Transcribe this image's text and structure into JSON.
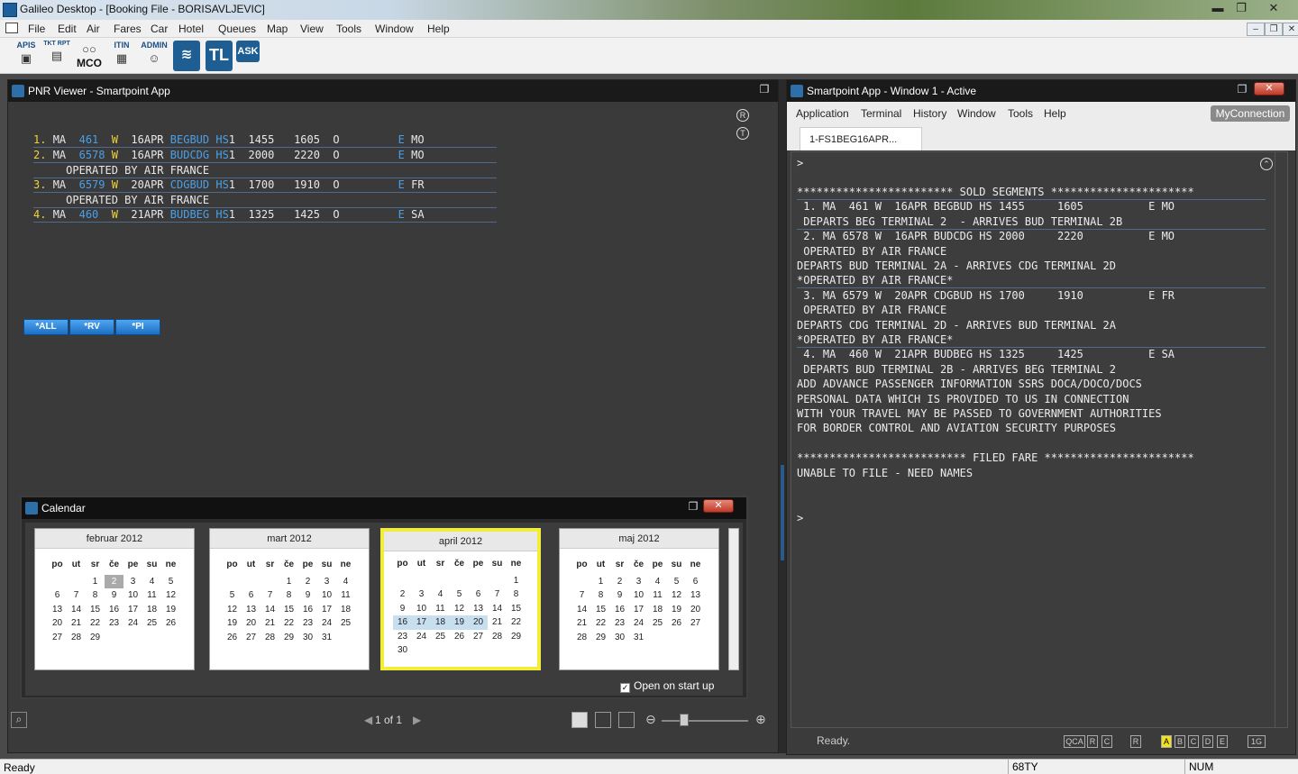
{
  "window": {
    "title": "Galileo Desktop - [Booking File - BORISAVLJEVIC]"
  },
  "menu": [
    "File",
    "Edit",
    "Air",
    "Fares",
    "Car",
    "Hotel",
    "Queues",
    "Map",
    "View",
    "Tools",
    "Window",
    "Help"
  ],
  "toolbar": {
    "apis": "APIS",
    "tkt": "TKT RPT",
    "mco": "MCO",
    "itin": "ITIN",
    "admin": "ADMIN",
    "tl": "TL",
    "ask": "ASK"
  },
  "pnr": {
    "title": "PNR Viewer - Smartpoint App",
    "icon_r": "R",
    "icon_t": "T",
    "segments": [
      {
        "num": "1.",
        "car": "MA",
        "flt": "461",
        "cls": "W",
        "date": "16APR",
        "city": "BEGBUD",
        "hs": "HS",
        "n": "1",
        "dep": "1455",
        "arr": "1605",
        "o": "O",
        "e": "E",
        "day": "MO"
      },
      {
        "num": "2.",
        "car": "MA",
        "flt": "6578",
        "cls": "W",
        "date": "16APR",
        "city": "BUDCDG",
        "hs": "HS",
        "n": "1",
        "dep": "2000",
        "arr": "2220",
        "o": "O",
        "e": "E",
        "day": "MO",
        "op": "OPERATED BY AIR FRANCE"
      },
      {
        "num": "3.",
        "car": "MA",
        "flt": "6579",
        "cls": "W",
        "date": "20APR",
        "city": "CDGBUD",
        "hs": "HS",
        "n": "1",
        "dep": "1700",
        "arr": "1910",
        "o": "O",
        "e": "E",
        "day": "FR",
        "op": "OPERATED BY AIR FRANCE"
      },
      {
        "num": "4.",
        "car": "MA",
        "flt": "460",
        "cls": "W",
        "date": "21APR",
        "city": "BUDBEG",
        "hs": "HS",
        "n": "1",
        "dep": "1325",
        "arr": "1425",
        "o": "O",
        "e": "E",
        "day": "SA"
      }
    ],
    "buttons": [
      "*ALL",
      "*RV",
      "*PI"
    ],
    "page": "1 of 1"
  },
  "calendar": {
    "title": "Calendar",
    "weekdays": [
      "po",
      "ut",
      "sr",
      "če",
      "pe",
      "su",
      "ne"
    ],
    "open_on_start": "Open on start up",
    "months": [
      {
        "name": "februar 2012",
        "weeks": [
          [
            "",
            "",
            "1",
            "2",
            "3",
            "4",
            "5"
          ],
          [
            "6",
            "7",
            "8",
            "9",
            "10",
            "11",
            "12"
          ],
          [
            "13",
            "14",
            "15",
            "16",
            "17",
            "18",
            "19"
          ],
          [
            "20",
            "21",
            "22",
            "23",
            "24",
            "25",
            "26"
          ],
          [
            "27",
            "28",
            "29",
            "",
            "",
            "",
            ""
          ]
        ]
      },
      {
        "name": "mart 2012",
        "weeks": [
          [
            "",
            "",
            "",
            "1",
            "2",
            "3",
            "4"
          ],
          [
            "5",
            "6",
            "7",
            "8",
            "9",
            "10",
            "11"
          ],
          [
            "12",
            "13",
            "14",
            "15",
            "16",
            "17",
            "18"
          ],
          [
            "19",
            "20",
            "21",
            "22",
            "23",
            "24",
            "25"
          ],
          [
            "26",
            "27",
            "28",
            "29",
            "30",
            "31",
            ""
          ]
        ]
      },
      {
        "name": "april 2012",
        "weeks": [
          [
            "",
            "",
            "",
            "",
            "",
            "",
            "1"
          ],
          [
            "2",
            "3",
            "4",
            "5",
            "6",
            "7",
            "8"
          ],
          [
            "9",
            "10",
            "11",
            "12",
            "13",
            "14",
            "15"
          ],
          [
            "16",
            "17",
            "18",
            "19",
            "20",
            "21",
            "22"
          ],
          [
            "23",
            "24",
            "25",
            "26",
            "27",
            "28",
            "29"
          ],
          [
            "30",
            "",
            "",
            "",
            "",
            "",
            ""
          ]
        ]
      },
      {
        "name": "maj 2012",
        "weeks": [
          [
            "",
            "1",
            "2",
            "3",
            "4",
            "5",
            "6"
          ],
          [
            "7",
            "8",
            "9",
            "10",
            "11",
            "12",
            "13"
          ],
          [
            "14",
            "15",
            "16",
            "17",
            "18",
            "19",
            "20"
          ],
          [
            "21",
            "22",
            "23",
            "24",
            "25",
            "26",
            "27"
          ],
          [
            "28",
            "29",
            "30",
            "31",
            "",
            "",
            ""
          ]
        ]
      }
    ]
  },
  "smartpoint": {
    "title": "Smartpoint App - Window 1 - Active",
    "menu": [
      "Application",
      "Terminal",
      "History",
      "Window",
      "Tools",
      "Help"
    ],
    "connection": "MyConnection",
    "tab": "1-FS1BEG16APR...",
    "prompt": ">",
    "lines": [
      "************************ SOLD SEGMENTS **********************",
      " 1. MA  461 W  16APR BEGBUD HS 1455     1605          E MO",
      " DEPARTS BEG TERMINAL 2  - ARRIVES BUD TERMINAL 2B",
      " 2. MA 6578 W  16APR BUDCDG HS 2000     2220          E MO",
      " OPERATED BY AIR FRANCE",
      "DEPARTS BUD TERMINAL 2A - ARRIVES CDG TERMINAL 2D",
      "*OPERATED BY AIR FRANCE*",
      " 3. MA 6579 W  20APR CDGBUD HS 1700     1910          E FR",
      " OPERATED BY AIR FRANCE",
      "DEPARTS CDG TERMINAL 2D - ARRIVES BUD TERMINAL 2A",
      "*OPERATED BY AIR FRANCE*",
      " 4. MA  460 W  21APR BUDBEG HS 1325     1425          E SA",
      " DEPARTS BUD TERMINAL 2B - ARRIVES BEG TERMINAL 2",
      "ADD ADVANCE PASSENGER INFORMATION SSRS DOCA/DOCO/DOCS",
      "PERSONAL DATA WHICH IS PROVIDED TO US IN CONNECTION",
      "WITH YOUR TRAVEL MAY BE PASSED TO GOVERNMENT AUTHORITIES",
      "FOR BORDER CONTROL AND AVIATION SECURITY PURPOSES",
      "",
      "************************** FILED FARE ***********************",
      "UNABLE TO FILE - NEED NAMES"
    ],
    "status": "Ready.",
    "keys": [
      "QCA",
      "R",
      "C",
      "R",
      "A",
      "B",
      "C",
      "D",
      "E",
      "1G"
    ]
  },
  "statusbar": {
    "left": "Ready",
    "mid": "68TY",
    "right": "NUM"
  }
}
